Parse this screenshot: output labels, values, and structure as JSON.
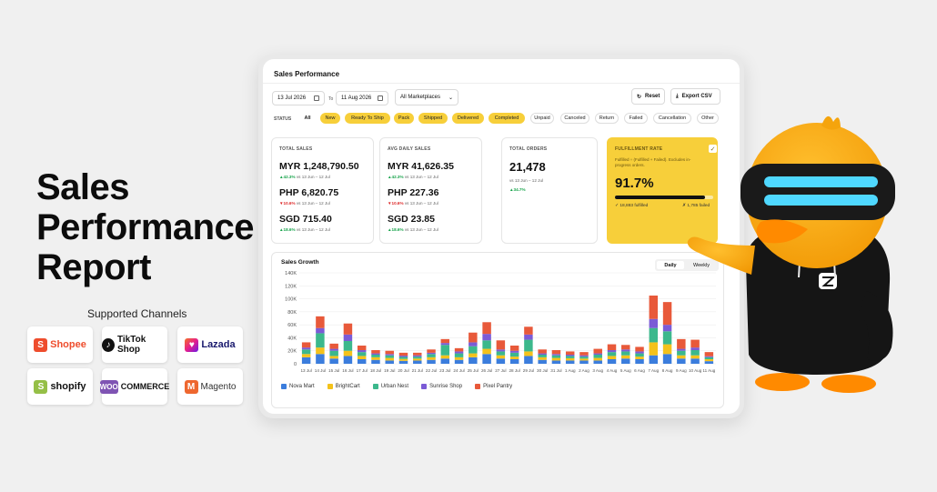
{
  "hero": {
    "title_lines": [
      "Sales",
      "Performance",
      "Report"
    ],
    "channels_heading": "Supported Channels"
  },
  "channels": [
    "Shopee",
    "TikTok Shop",
    "Lazada",
    "shopify",
    "COMMERCE",
    "Magento"
  ],
  "channel_marks": {
    "woo": "WOO"
  },
  "app": {
    "title": "Sales Performance",
    "date_from": "13 Jul 2026",
    "to_label": "To",
    "date_to": "11 Aug 2026",
    "marketplace": "All Marketplaces",
    "reset": "Reset",
    "export": "Export CSV",
    "status_label": "STATUS",
    "status_chips": [
      "All",
      "New",
      "Ready To Ship",
      "Pack",
      "Shipped",
      "Delivered",
      "Completed",
      "Unpaid",
      "Canceled",
      "Return",
      "Failed",
      "Cancellation",
      "Other"
    ]
  },
  "cards": {
    "total_sales": {
      "label": "TOTAL SALES",
      "rows": [
        {
          "value": "MYR 1,248,790.50",
          "delta": "▲42.3%",
          "compare": "vs 13 Jun – 12 Jul"
        },
        {
          "value": "PHP 6,820.75",
          "delta": "▼10.6%",
          "compare": "vs 13 Jun – 12 Jul"
        },
        {
          "value": "SGD 715.40",
          "delta": "▲18.6%",
          "compare": "vs 13 Jun – 12 Jul"
        }
      ]
    },
    "avg_daily": {
      "label": "AVG DAILY SALES",
      "rows": [
        {
          "value": "MYR 41,626.35",
          "delta": "▲42.3%",
          "compare": "vs 13 Jun – 12 Jul"
        },
        {
          "value": "PHP 227.36",
          "delta": "▼10.6%",
          "compare": "vs 13 Jun – 12 Jul"
        },
        {
          "value": "SGD 23.85",
          "delta": "▲18.6%",
          "compare": "vs 13 Jun – 12 Jul"
        }
      ]
    },
    "total_orders": {
      "label": "TOTAL ORDERS",
      "value": "21,478",
      "compare": "vs 13 Jun – 12 Jul",
      "delta": "▲34.7%"
    },
    "fulfillment": {
      "label": "FULFILLMENT RATE",
      "description": "Fulfilled ÷ (Fulfilled + Failed). Excludes in-progress orders.",
      "rate": "91.7%",
      "rate_fraction": 0.917,
      "fulfilled": "✓ 18,883 fulfilled",
      "failed": "✗ 1,785 failed"
    }
  },
  "colors": {
    "accent": "#f7cf3a",
    "up": "#16a34a",
    "down": "#dc2626"
  },
  "chart_data": {
    "type": "bar",
    "stacked": true,
    "title": "Sales Growth",
    "toggle": [
      "Daily",
      "Weekly"
    ],
    "selected_toggle": "Daily",
    "ylim": [
      0,
      140000
    ],
    "yticks": [
      "0",
      "20K",
      "40K",
      "60K",
      "80K",
      "100K",
      "120K",
      "140K"
    ],
    "grid": true,
    "legend_position": "bottom",
    "categories": [
      "13 Jul",
      "14 Jul",
      "15 Jul",
      "16 Jul",
      "17 Jul",
      "18 Jul",
      "19 Jul",
      "20 Jul",
      "21 Jul",
      "22 Jul",
      "23 Jul",
      "24 Jul",
      "25 Jul",
      "26 Jul",
      "27 Jul",
      "28 Jul",
      "29 Jul",
      "30 Jul",
      "31 Jul",
      "1 Aug",
      "2 Aug",
      "3 Aug",
      "4 Aug",
      "5 Aug",
      "6 Aug",
      "7 Aug",
      "8 Aug",
      "9 Aug",
      "10 Aug",
      "11 Aug"
    ],
    "series": [
      {
        "name": "Nova Mart",
        "color": "#3b7ddd",
        "values": [
          10000,
          15000,
          8000,
          12000,
          7000,
          6000,
          5000,
          4500,
          5000,
          6000,
          8000,
          6000,
          10000,
          15000,
          8000,
          7000,
          12000,
          6000,
          5000,
          5000,
          5000,
          5000,
          7000,
          8000,
          7000,
          13000,
          15000,
          8000,
          8000,
          4000
        ]
      },
      {
        "name": "BrightCart",
        "color": "#f4c21b",
        "values": [
          5000,
          10000,
          4000,
          8000,
          5000,
          4000,
          4000,
          3000,
          3000,
          4000,
          5000,
          4000,
          6000,
          8000,
          5000,
          4000,
          7000,
          4000,
          4000,
          3500,
          3000,
          4000,
          5000,
          5000,
          4000,
          20000,
          15000,
          5000,
          5000,
          3000
        ]
      },
      {
        "name": "Urban Nest",
        "color": "#3cb88c",
        "values": [
          7000,
          22000,
          8000,
          15000,
          6000,
          4000,
          4000,
          3000,
          3000,
          5000,
          16000,
          6000,
          11000,
          13000,
          6000,
          6000,
          18000,
          4000,
          4000,
          3500,
          3000,
          5000,
          6000,
          6000,
          5000,
          22000,
          20000,
          7000,
          8000,
          3000
        ]
      },
      {
        "name": "Sunrise Shop",
        "color": "#7b5bd6",
        "values": [
          3000,
          8000,
          3000,
          10000,
          3000,
          2000,
          2000,
          2000,
          2000,
          2000,
          3000,
          3000,
          6000,
          10000,
          3000,
          3000,
          8000,
          2000,
          2000,
          2000,
          2000,
          2000,
          3000,
          3000,
          3000,
          14000,
          10000,
          3000,
          4000,
          1500
        ]
      },
      {
        "name": "Pixel Pantry",
        "color": "#e8593a",
        "values": [
          8000,
          18000,
          8000,
          17000,
          7000,
          5000,
          5000,
          4500,
          4000,
          5000,
          6000,
          5000,
          15000,
          18000,
          14000,
          8000,
          12000,
          6000,
          6000,
          5000,
          5000,
          7000,
          9000,
          7000,
          7000,
          36000,
          35000,
          15000,
          12000,
          6500
        ]
      }
    ]
  }
}
